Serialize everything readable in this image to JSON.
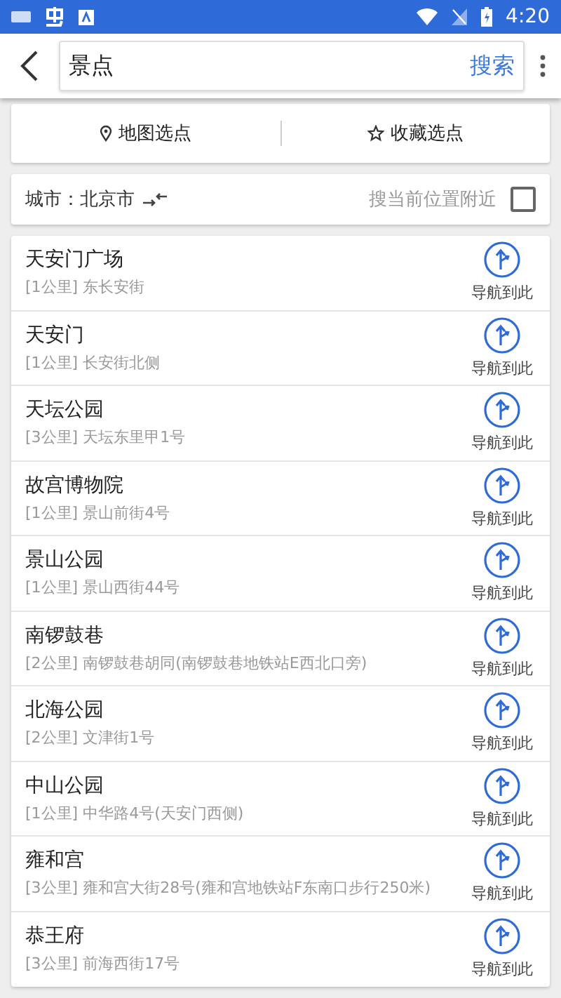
{
  "status_bar": {
    "time": "4:20"
  },
  "search": {
    "value": "景点",
    "button": "搜索"
  },
  "pick_options": [
    {
      "label": "地图选点",
      "kind": "map"
    },
    {
      "label": "收藏选点",
      "kind": "favorite"
    }
  ],
  "city": {
    "label": "城市：北京市",
    "nearby_label": "搜当前位置附近",
    "nearby_checked": false
  },
  "results": [
    {
      "name": "天安门广场",
      "distance": "[1公里]",
      "address": "东长安街",
      "nav_label": "导航到此"
    },
    {
      "name": "天安门",
      "distance": "[1公里]",
      "address": "长安街北侧",
      "nav_label": "导航到此"
    },
    {
      "name": "天坛公园",
      "distance": "[3公里]",
      "address": "天坛东里甲1号",
      "nav_label": "导航到此"
    },
    {
      "name": "故宫博物院",
      "distance": "[1公里]",
      "address": "景山前街4号",
      "nav_label": "导航到此"
    },
    {
      "name": "景山公园",
      "distance": "[1公里]",
      "address": "景山西街44号",
      "nav_label": "导航到此"
    },
    {
      "name": "南锣鼓巷",
      "distance": "[2公里]",
      "address": "南锣鼓巷胡同(南锣鼓巷地铁站E西北口旁)",
      "nav_label": "导航到此"
    },
    {
      "name": "北海公园",
      "distance": "[2公里]",
      "address": "文津街1号",
      "nav_label": "导航到此"
    },
    {
      "name": "中山公园",
      "distance": "[1公里]",
      "address": "中华路4号(天安门西侧)",
      "nav_label": "导航到此"
    },
    {
      "name": "雍和宫",
      "distance": "[3公里]",
      "address": "雍和宫大街28号(雍和宫地铁站F东南口步行250米)",
      "nav_label": "导航到此"
    },
    {
      "name": "恭王府",
      "distance": "[3公里]",
      "address": "前海西街17号",
      "nav_label": "导航到此"
    }
  ]
}
